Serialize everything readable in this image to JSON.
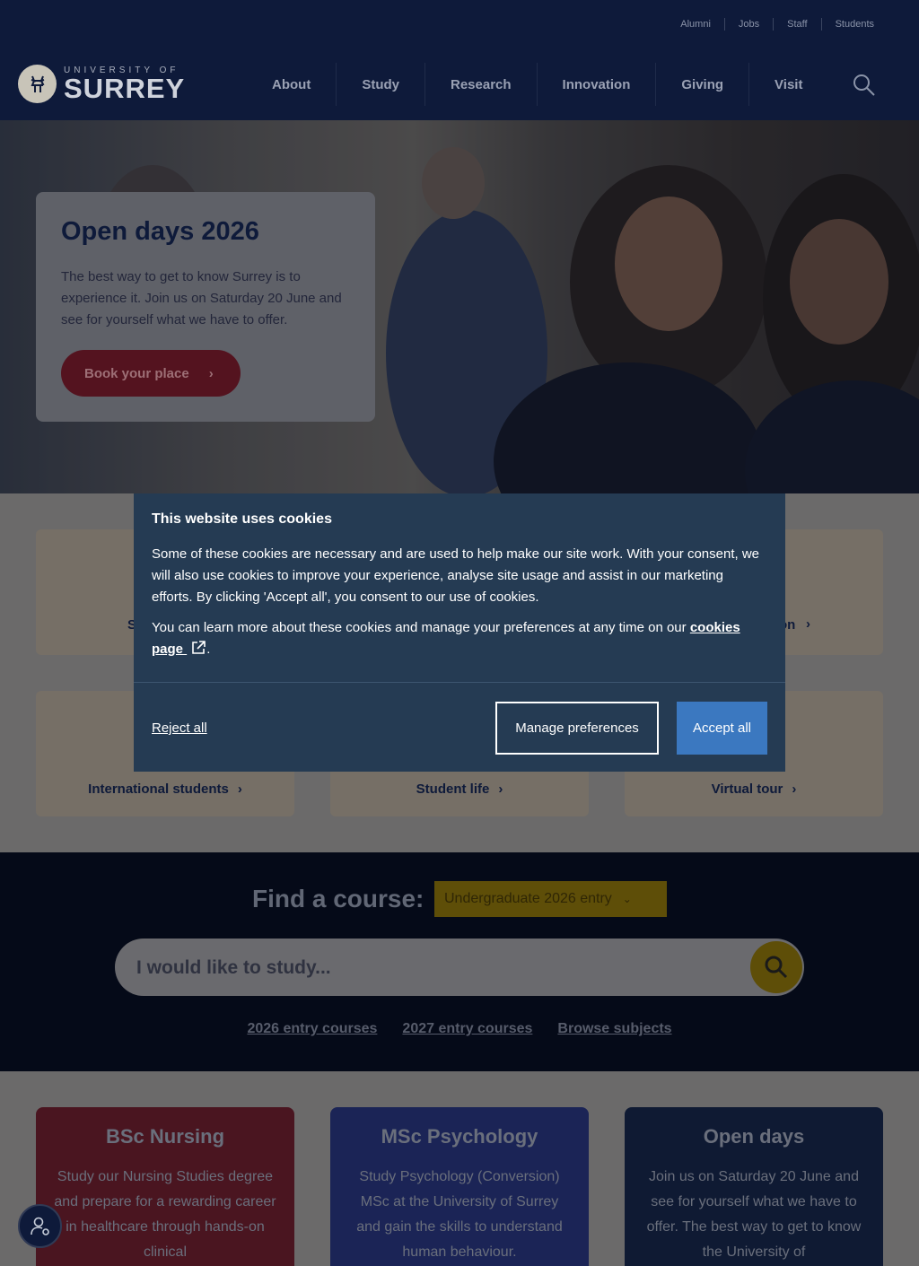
{
  "header": {
    "utility_links": [
      "Alumni",
      "Jobs",
      "Staff",
      "Students"
    ],
    "logo_small": "UNIVERSITY OF",
    "logo_big": "SURREY",
    "nav": [
      "About",
      "Study",
      "Research",
      "Innovation",
      "Giving",
      "Visit"
    ]
  },
  "hero": {
    "title": "Open days 2026",
    "text": "The best way to get to know Surrey is to experience it. Join us on Saturday 20 June and see for yourself what we have to offer.",
    "button": "Book your place"
  },
  "quick_links": {
    "row1_left_partial": "S",
    "row1_right_partial": "on",
    "row2": [
      "International students",
      "Student life",
      "Virtual tour"
    ]
  },
  "find_course": {
    "title": "Find a course:",
    "select_value": "Undergraduate 2026 entry",
    "search_placeholder": "I would like to study...",
    "links": [
      "2026 entry courses",
      "2027 entry courses",
      "Browse subjects"
    ]
  },
  "promos": [
    {
      "title": "BSc Nursing",
      "text": "Study our Nursing Studies degree and prepare for a rewarding career in healthcare through hands-on clinical",
      "color": "#4a1520"
    },
    {
      "title": "MSc Psychology",
      "text": "Study Psychology (Conversion) MSc at the University of Surrey and gain the skills to understand human behaviour.",
      "color": "#1b2456"
    },
    {
      "title": "Open days",
      "text": "Join us on Saturday 20 June and see for yourself what we have to offer. The best way to get to know the University of",
      "color": "#0f1a33"
    }
  ],
  "cookie": {
    "title": "This website uses cookies",
    "para1": "Some of these cookies are necessary and are used to help make our site work. With your consent, we will also use cookies to improve your experience, analyse site usage and assist in our marketing efforts. By clicking 'Accept all', you consent to our use of cookies.",
    "para2_pre": "You can learn more about these cookies and manage your preferences at any time on our",
    "link": "cookies page",
    "para2_post": ".",
    "reject": "Reject all",
    "manage": "Manage preferences",
    "accept": "Accept all"
  },
  "colors": {
    "navy": "#0e1a3a",
    "cookie_bg": "#253b53",
    "accept_blue": "#3b78c0",
    "book_red": "#54131f",
    "select_yellow": "#5e4e08"
  }
}
